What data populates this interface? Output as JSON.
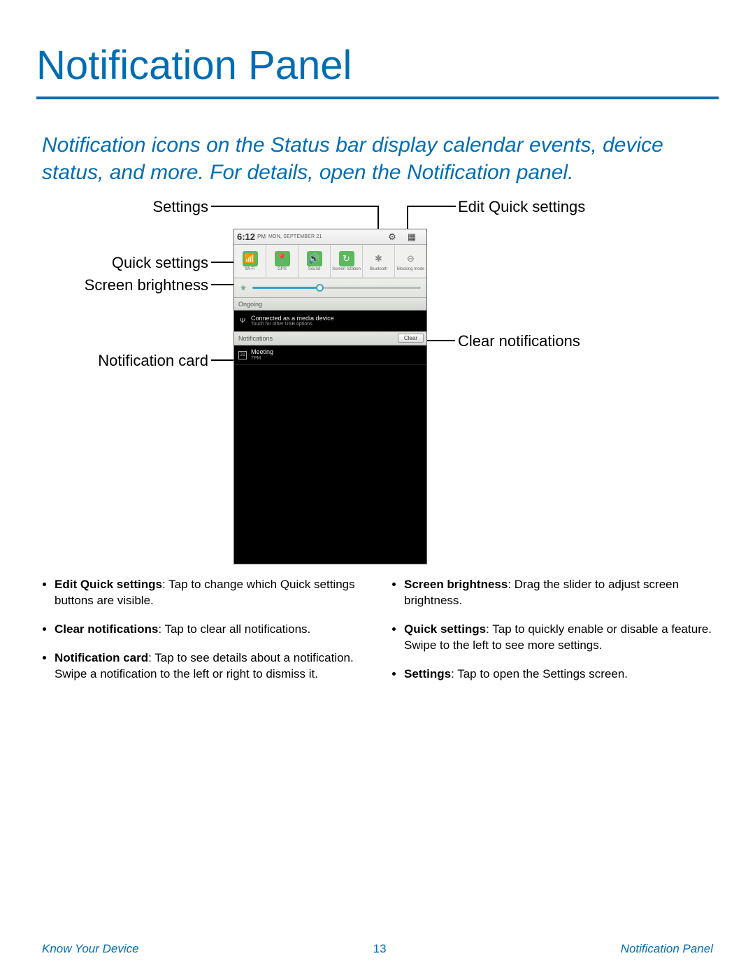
{
  "title": "Notification Panel",
  "intro": "Notification icons on the Status bar display calendar events, device status, and more. For details, open the Notification panel.",
  "callouts": {
    "settings": "Settings",
    "edit_quick": "Edit Quick settings",
    "quick_settings": "Quick settings",
    "screen_brightness": "Screen brightness",
    "notification_card": "Notification card",
    "clear_notifications": "Clear notifications"
  },
  "phone": {
    "time": "6:12",
    "ampm": "PM",
    "date": "MON, SEPTEMBER 21",
    "quick_tiles": [
      {
        "label": "Wi-Fi",
        "on": true,
        "glyph": "📶"
      },
      {
        "label": "GPS",
        "on": true,
        "glyph": "📍"
      },
      {
        "label": "Sound",
        "on": true,
        "glyph": "🔊"
      },
      {
        "label": "Screen rotation",
        "on": true,
        "glyph": "↻"
      },
      {
        "label": "Bluetooth",
        "on": false,
        "glyph": "✱"
      },
      {
        "label": "Blocking mode",
        "on": false,
        "glyph": "⊖"
      }
    ],
    "ongoing_header": "Ongoing",
    "ongoing_title": "Connected as a media device",
    "ongoing_sub": "Touch for other USB options.",
    "notifications_header": "Notifications",
    "clear_label": "Clear",
    "card_title": "Meeting",
    "card_sub": "7PM"
  },
  "bullets_left": [
    {
      "term": "Edit Quick settings",
      "text": ": Tap to change which Quick settings buttons are visible."
    },
    {
      "term": "Clear notifications",
      "text": ": Tap to clear all notifications."
    },
    {
      "term": "Notification card",
      "text": ": Tap to see details about a notification. Swipe a notification to the left or right to dismiss it."
    }
  ],
  "bullets_right": [
    {
      "term": "Screen brightness",
      "text": ": Drag the slider to adjust screen brightness."
    },
    {
      "term": "Quick settings",
      "text": ": Tap to quickly enable or disable a feature. Swipe to the left to see more settings."
    },
    {
      "term": "Settings",
      "text": ": Tap to open the Settings screen."
    }
  ],
  "footer": {
    "left": "Know Your Device",
    "page": "13",
    "right": "Notification Panel"
  }
}
